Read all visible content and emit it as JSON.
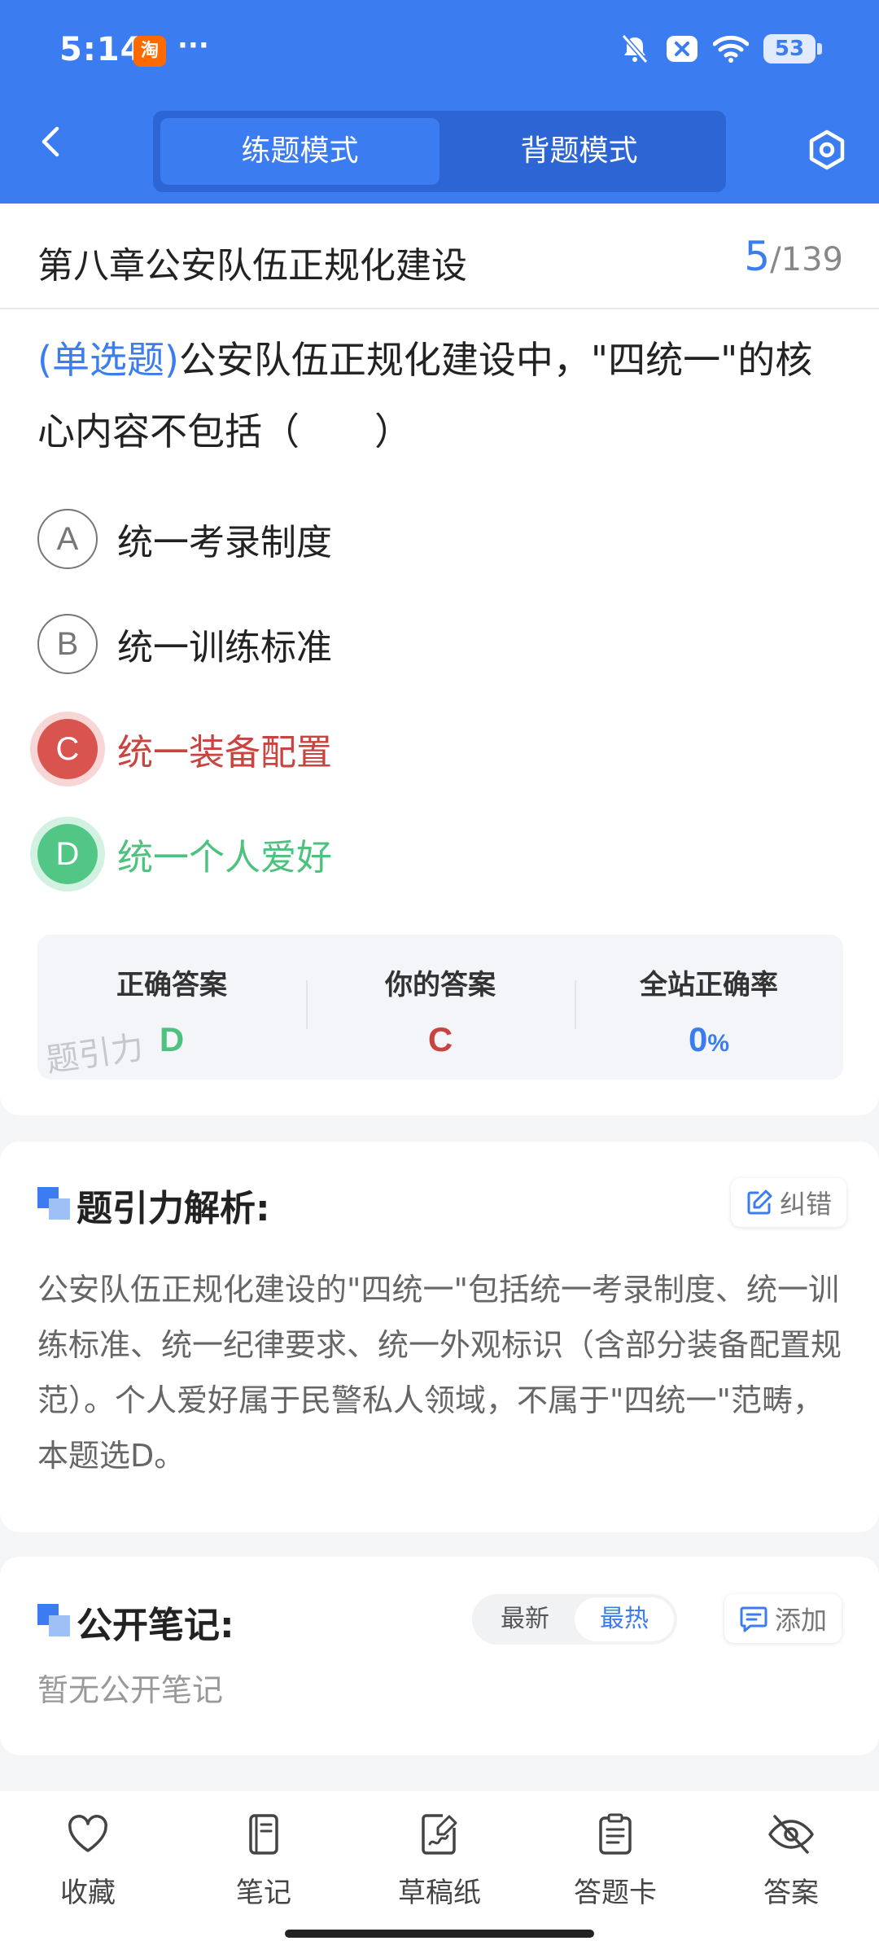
{
  "status_bar": {
    "time": "5:14",
    "app_badge": "淘",
    "more": "···",
    "battery": "53"
  },
  "header": {
    "modes": [
      "练题模式",
      "背题模式"
    ],
    "active_mode": "练题模式",
    "accent": "#3b7cf0"
  },
  "question": {
    "chapter": "第八章公安队伍正规化建设",
    "current": "5",
    "total": "/139",
    "type": "(单选题)",
    "stem": "公安队伍正规化建设中，\"四统一\"的核心内容不包括（　　）",
    "options": [
      {
        "key": "A",
        "text": "统一考录制度",
        "state": "normal"
      },
      {
        "key": "B",
        "text": "统一训练标准",
        "state": "normal"
      },
      {
        "key": "C",
        "text": "统一装备配置",
        "state": "wrong"
      },
      {
        "key": "D",
        "text": "统一个人爱好",
        "state": "correct"
      }
    ]
  },
  "answer": {
    "correct_label": "正确答案",
    "correct_value": "D",
    "yours_label": "你的答案",
    "yours_value": "C",
    "rate_label": "全站正确率",
    "rate_value": "0",
    "rate_unit": "%",
    "watermark": "题引力"
  },
  "analysis": {
    "title": "题引力解析:",
    "report_label": "纠错",
    "text": "公安队伍正规化建设的\"四统一\"包括统一考录制度、统一训练标准、统一纪律要求、统一外观标识（含部分装备配置规范）。个人爱好属于民警私人领域，不属于\"四统一\"范畴，本题选D。"
  },
  "notes": {
    "title": "公开笔记:",
    "sort_options": [
      "最新",
      "最热"
    ],
    "active_sort": "最热",
    "add_label": "添加",
    "empty_text": "暂无公开笔记"
  },
  "bottom_nav": [
    {
      "label": "收藏",
      "icon": "heart-icon"
    },
    {
      "label": "笔记",
      "icon": "notebook-icon"
    },
    {
      "label": "草稿纸",
      "icon": "draft-paper-icon"
    },
    {
      "label": "答题卡",
      "icon": "answer-sheet-icon"
    },
    {
      "label": "答案",
      "icon": "eye-off-icon"
    }
  ]
}
